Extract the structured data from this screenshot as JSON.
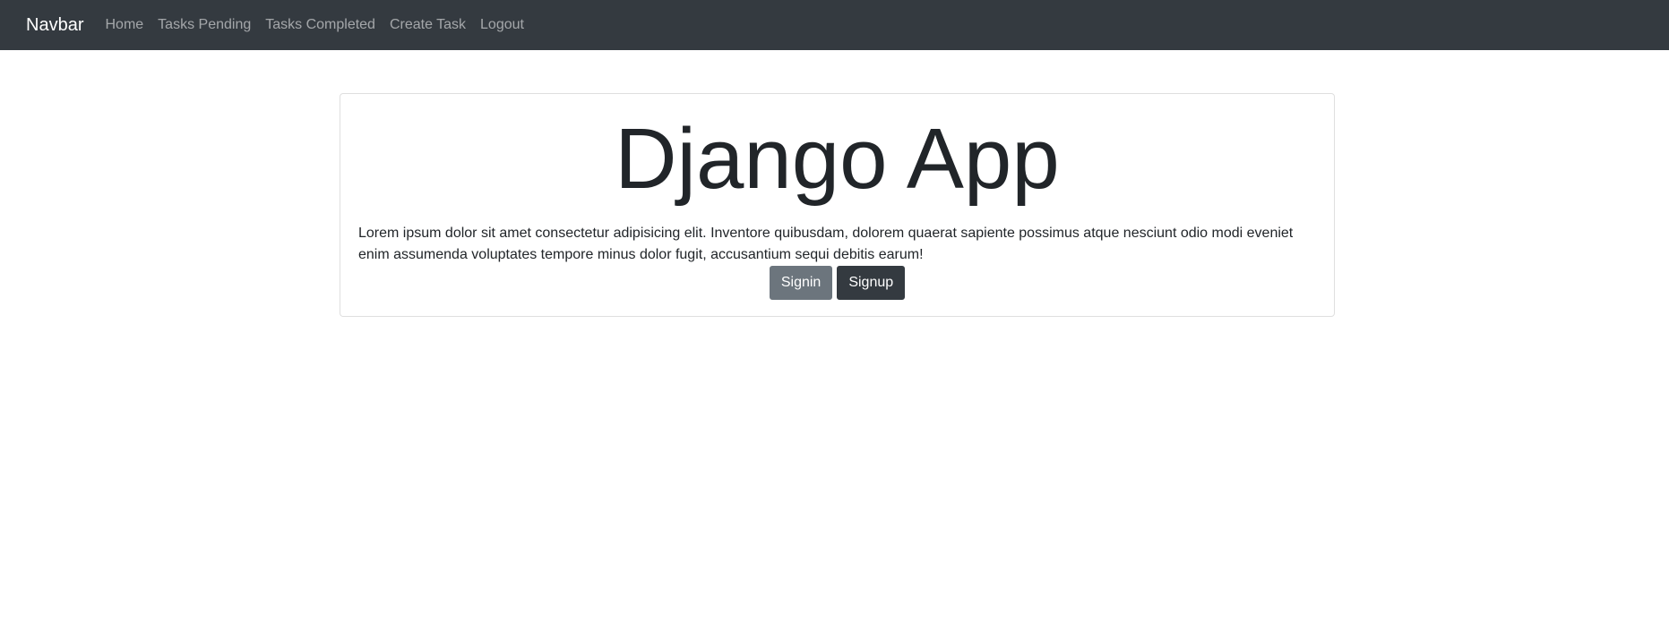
{
  "navbar": {
    "brand": "Navbar",
    "links": [
      {
        "label": "Home"
      },
      {
        "label": "Tasks Pending"
      },
      {
        "label": "Tasks Completed"
      },
      {
        "label": "Create Task"
      },
      {
        "label": "Logout"
      }
    ]
  },
  "hero": {
    "title": "Django App",
    "lead": "Lorem ipsum dolor sit amet consectetur adipisicing elit. Inventore quibusdam, dolorem quaerat sapiente possimus atque nesciunt odio modi eveniet enim assumenda voluptates tempore minus dolor fugit, accusantium sequi debitis earum!",
    "signin_label": "Signin",
    "signup_label": "Signup"
  },
  "colors": {
    "navbar_bg": "#343a40",
    "signin_bg": "#6c757d",
    "signup_bg": "#343a40"
  }
}
